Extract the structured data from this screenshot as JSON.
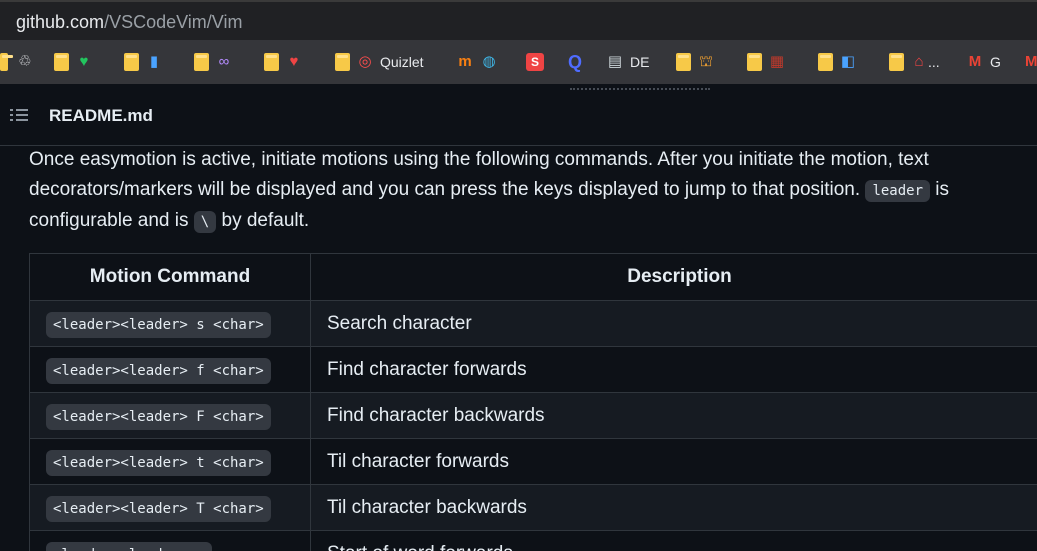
{
  "browser": {
    "url_host": "github.com",
    "url_path": "/VSCodeVim/Vim",
    "bookmarks": [
      {
        "type": "icon",
        "icon": "recycle-icon",
        "glyph": "♲",
        "color": "#e8eaed"
      },
      {
        "type": "folder-icon",
        "icon": "heart-green-icon",
        "glyph": "♥",
        "color": "#22c55e"
      },
      {
        "type": "folder-icon",
        "icon": "phone-icon",
        "glyph": "▮",
        "color": "#4aa3ff"
      },
      {
        "type": "folder-icon",
        "icon": "infinity-icon",
        "glyph": "∞",
        "color": "#b58cff"
      },
      {
        "type": "folder-icon",
        "icon": "heart-red-icon",
        "glyph": "♥",
        "color": "#ef4444"
      },
      {
        "type": "folder-icon",
        "icon": "quizlet-icon",
        "glyph": "◎",
        "color": "#ff4d4d",
        "label": "Quizlet"
      },
      {
        "type": "icon",
        "icon": "moodle-icon",
        "glyph": "m",
        "color": "#f98012"
      },
      {
        "type": "icon",
        "icon": "globe-icon",
        "glyph": "◍",
        "color": "#3fb6e6"
      },
      {
        "type": "icon",
        "icon": "red-badge-icon",
        "glyph": "S",
        "color": "#ef4444"
      },
      {
        "type": "icon",
        "icon": "q-icon",
        "glyph": "Q",
        "color": "#4f6cff"
      },
      {
        "type": "icon",
        "icon": "doc-icon",
        "glyph": "▤",
        "color": "#cfd8dc",
        "label": "DE"
      },
      {
        "type": "folder-icon",
        "icon": "crane-icon",
        "glyph": "⛫",
        "color": "#f0a030"
      },
      {
        "type": "folder-icon",
        "icon": "abacus-icon",
        "glyph": "▦",
        "color": "#c0392b"
      },
      {
        "type": "folder-icon",
        "icon": "backpack-icon",
        "glyph": "◧",
        "color": "#4aa3ff"
      },
      {
        "type": "folder-icon",
        "icon": "house-icon",
        "glyph": "⌂",
        "color": "#ef4444",
        "label": "..."
      },
      {
        "type": "icon",
        "icon": "gmail-icon",
        "glyph": "M",
        "color": "#ea4335",
        "label": "G"
      },
      {
        "type": "icon",
        "icon": "gmail-icon-2",
        "glyph": "M",
        "color": "#ea4335"
      }
    ]
  },
  "readme": {
    "title": "README.md"
  },
  "paragraph": {
    "part1": "Once easymotion is active, initiate motions using the following commands. After you initiate the motion, text decorators/markers will be displayed and you can press the keys displayed to jump to that position. ",
    "code1": "leader",
    "part2": " is configurable and is ",
    "code2": "\\",
    "part3": " by default."
  },
  "table": {
    "headers": [
      "Motion Command",
      "Description"
    ],
    "rows": [
      {
        "cmd": "<leader><leader> s <char>",
        "desc": "Search character"
      },
      {
        "cmd": "<leader><leader> f <char>",
        "desc": "Find character forwards"
      },
      {
        "cmd": "<leader><leader> F <char>",
        "desc": "Find character backwards"
      },
      {
        "cmd": "<leader><leader> t <char>",
        "desc": "Til character forwards"
      },
      {
        "cmd": "<leader><leader> T <char>",
        "desc": "Til character backwards"
      },
      {
        "cmd": "<leader><leader> w",
        "desc": "Start of word forwards"
      }
    ]
  }
}
